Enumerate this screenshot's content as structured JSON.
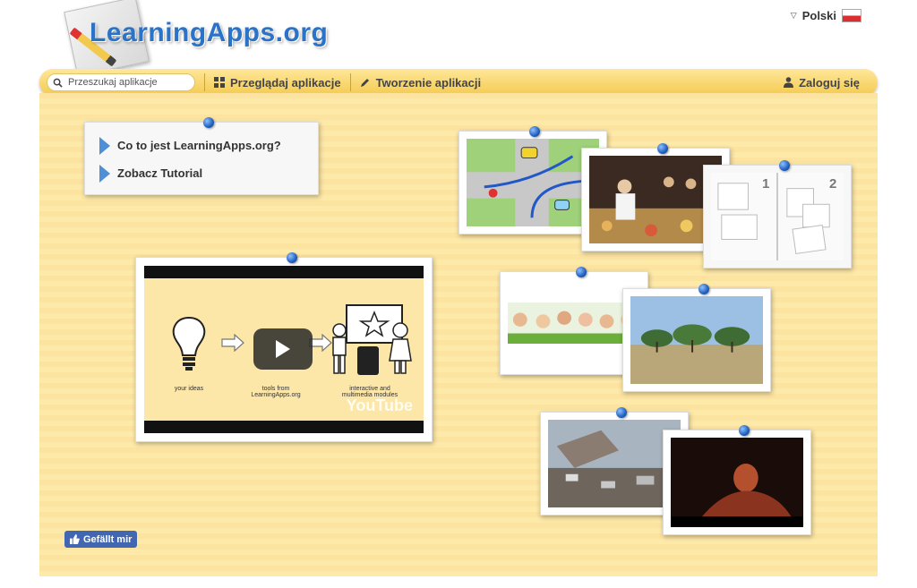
{
  "header": {
    "logo_text": "LearningApps.org",
    "language": "Polski"
  },
  "nav": {
    "search_placeholder": "Przeszukaj aplikacje",
    "browse": "Przeglądaj aplikacje",
    "create": "Tworzenie aplikacji",
    "login": "Zaloguj się"
  },
  "links": {
    "what_is": "Co to jest LearningApps.org?",
    "tutorial": "Zobacz Tutorial"
  },
  "video": {
    "caption_1": "your ideas",
    "caption_2": "tools from LearningApps.org",
    "caption_3": "interactive and multimedia modules",
    "brand": "YouTube"
  },
  "gallery": {
    "book_page_1": "1",
    "book_page_2": "2"
  },
  "facebook": {
    "like_label": "Gefällt mir"
  },
  "colors": {
    "accent": "#2b73c7",
    "nav_bar": "#f4c94e",
    "background": "#fde6a4",
    "facebook": "#4267b2"
  }
}
